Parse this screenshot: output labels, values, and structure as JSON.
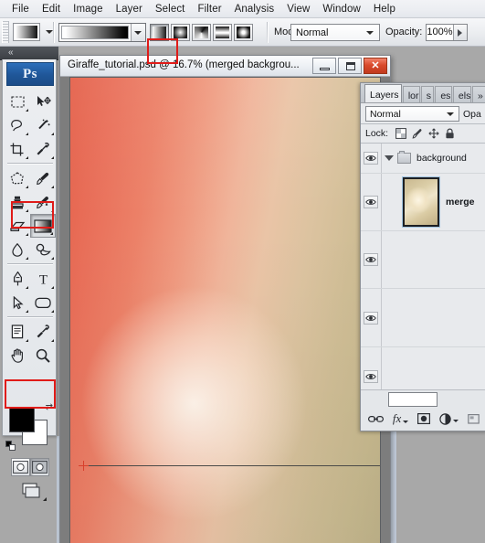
{
  "menubar": {
    "items": [
      {
        "label": "File"
      },
      {
        "label": "Edit"
      },
      {
        "label": "Image"
      },
      {
        "label": "Layer"
      },
      {
        "label": "Select"
      },
      {
        "label": "Filter"
      },
      {
        "label": "Analysis"
      },
      {
        "label": "View"
      },
      {
        "label": "Window"
      },
      {
        "label": "Help"
      }
    ]
  },
  "options_bar": {
    "tool": "gradient-tool",
    "gradient_preset_name": "Foreground to Background",
    "gradient_types": [
      {
        "name": "linear-gradient",
        "label": "Linear Gradient",
        "selected": true
      },
      {
        "name": "radial-gradient",
        "label": "Radial Gradient",
        "selected": false
      },
      {
        "name": "angle-gradient",
        "label": "Angle Gradient",
        "selected": false
      },
      {
        "name": "reflected-gradient",
        "label": "Reflected Gradient",
        "selected": false
      },
      {
        "name": "diamond-gradient",
        "label": "Diamond Gradient",
        "selected": false
      }
    ],
    "mode_label": "Mode:",
    "mode_value": "Normal",
    "opacity_label": "Opacity:",
    "opacity_value": "100%"
  },
  "document_window": {
    "title": "Giraffe_tutorial.psd @ 16.7% (merged backgrou...",
    "file_name": "Giraffe_tutorial.psd",
    "zoom": "16.7%",
    "layer_note": "merged backgrou...",
    "minimize_label": "Minimize",
    "restore_label": "Restore",
    "close_label": "Close",
    "close_glyph": "✕"
  },
  "toolbox": {
    "logo": "Ps",
    "collapse_glyph": "«",
    "tools": [
      {
        "name": "rectangular-marquee-tool",
        "label": "Rectangular Marquee Tool"
      },
      {
        "name": "move-tool",
        "label": "Move Tool"
      },
      {
        "name": "lasso-tool",
        "label": "Lasso Tool"
      },
      {
        "name": "magic-wand-tool",
        "label": "Magic Wand Tool"
      },
      {
        "name": "crop-tool",
        "label": "Crop Tool"
      },
      {
        "name": "eyedropper-tool",
        "label": "Eyedropper Tool"
      },
      {
        "name": "patch-tool",
        "label": "Spot Healing Brush Tool"
      },
      {
        "name": "brush-tool",
        "label": "Brush Tool"
      },
      {
        "name": "clone-stamp-tool",
        "label": "Clone Stamp Tool"
      },
      {
        "name": "history-brush-tool",
        "label": "History Brush Tool"
      },
      {
        "name": "eraser-tool",
        "label": "Eraser Tool"
      },
      {
        "name": "gradient-tool",
        "label": "Gradient Tool",
        "selected": true
      },
      {
        "name": "blur-tool",
        "label": "Blur Tool"
      },
      {
        "name": "dodge-tool",
        "label": "Dodge Tool"
      },
      {
        "name": "pen-tool",
        "label": "Pen Tool"
      },
      {
        "name": "type-tool",
        "label": "Horizontal Type Tool"
      },
      {
        "name": "path-selection-tool",
        "label": "Path Selection Tool"
      },
      {
        "name": "rectangle-tool",
        "label": "Rectangle Tool"
      },
      {
        "name": "notes-tool",
        "label": "Notes Tool"
      },
      {
        "name": "color-sampler-tool",
        "label": "Color Sampler Tool"
      },
      {
        "name": "hand-tool",
        "label": "Hand Tool"
      },
      {
        "name": "zoom-tool",
        "label": "Zoom Tool"
      }
    ],
    "foreground_color": "#000000",
    "background_color": "#ffffff",
    "swap_glyph": "⇄",
    "quick_mask_label": "Edit in Quick Mask Mode",
    "standard_mode_label": "Edit in Standard Mode",
    "screen_mode_label": "Change Screen Mode"
  },
  "layers_panel": {
    "tabs": [
      {
        "label": "Layers",
        "active": true,
        "closable": true
      },
      {
        "label": "lor",
        "active": false
      },
      {
        "label": "s",
        "active": false
      },
      {
        "label": "es",
        "active": false
      },
      {
        "label": "els",
        "active": false
      },
      {
        "label": "»",
        "active": false
      }
    ],
    "close_glyph": "✕",
    "blend_mode": "Normal",
    "opacity_label": "Opa",
    "lock_label": "Lock:",
    "lock_icons": [
      {
        "name": "lock-transparent-pixels-icon"
      },
      {
        "name": "lock-image-pixels-icon"
      },
      {
        "name": "lock-position-icon"
      },
      {
        "name": "lock-all-icon"
      }
    ],
    "layers": [
      {
        "name": "background",
        "type": "group",
        "visible": true,
        "expanded": true,
        "has_thumb": false
      },
      {
        "name": "merge",
        "type": "layer",
        "visible": true,
        "has_thumb": true,
        "selected": true
      },
      {
        "name": "",
        "type": "layer",
        "visible": true,
        "has_thumb": false
      },
      {
        "name": "",
        "type": "layer",
        "visible": true,
        "has_thumb": false
      },
      {
        "name": "",
        "type": "layer",
        "visible": true,
        "has_thumb": false
      }
    ],
    "bottom_icons": [
      {
        "name": "link-layers-icon",
        "glyph": "⚭"
      },
      {
        "name": "layer-style-fx-icon",
        "glyph": "fx"
      },
      {
        "name": "add-layer-mask-icon",
        "glyph": "▣"
      },
      {
        "name": "new-adjustment-layer-icon",
        "glyph": "◑"
      },
      {
        "name": "new-group-icon",
        "glyph": "▢"
      }
    ]
  },
  "canvas": {
    "gradient_colors": [
      "#e4604a",
      "#f0b49a",
      "#bfb289"
    ],
    "drag_line_label": "gradient drag line"
  },
  "highlights": [
    {
      "name": "gradient-type-highlight",
      "target": "linear-gradient-button"
    },
    {
      "name": "gradient-tool-highlight",
      "target": "gradient-tool"
    },
    {
      "name": "quick-mask-highlight",
      "target": "quick-mask-button"
    }
  ]
}
